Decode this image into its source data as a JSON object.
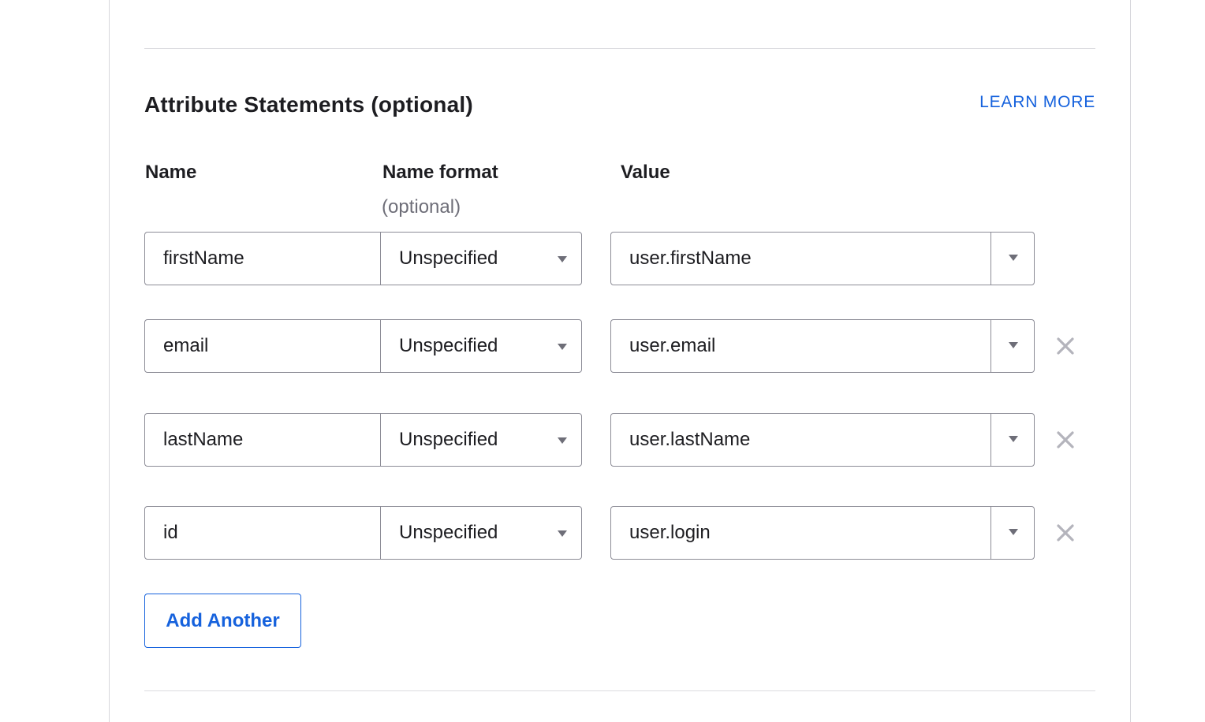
{
  "section": {
    "title": "Attribute Statements (optional)",
    "learn_more": "LEARN MORE"
  },
  "columns": {
    "name": "Name",
    "name_format": "Name format",
    "name_format_sub": "(optional)",
    "value": "Value"
  },
  "rows": [
    {
      "name": "firstName",
      "format": "Unspecified",
      "value": "user.firstName",
      "removable": false
    },
    {
      "name": "email",
      "format": "Unspecified",
      "value": "user.email",
      "removable": true
    },
    {
      "name": "lastName",
      "format": "Unspecified",
      "value": "user.lastName",
      "removable": true
    },
    {
      "name": "id",
      "format": "Unspecified",
      "value": "user.login",
      "removable": true
    }
  ],
  "add_button": "Add Another",
  "icons": {
    "dropdown": "chevron-down-icon",
    "remove": "close-icon"
  },
  "colors": {
    "accent": "#1662dd",
    "border": "#8c8c96",
    "text": "#1d1d21",
    "muted": "#6e6e78",
    "remove_icon": "#b4b4bc"
  }
}
